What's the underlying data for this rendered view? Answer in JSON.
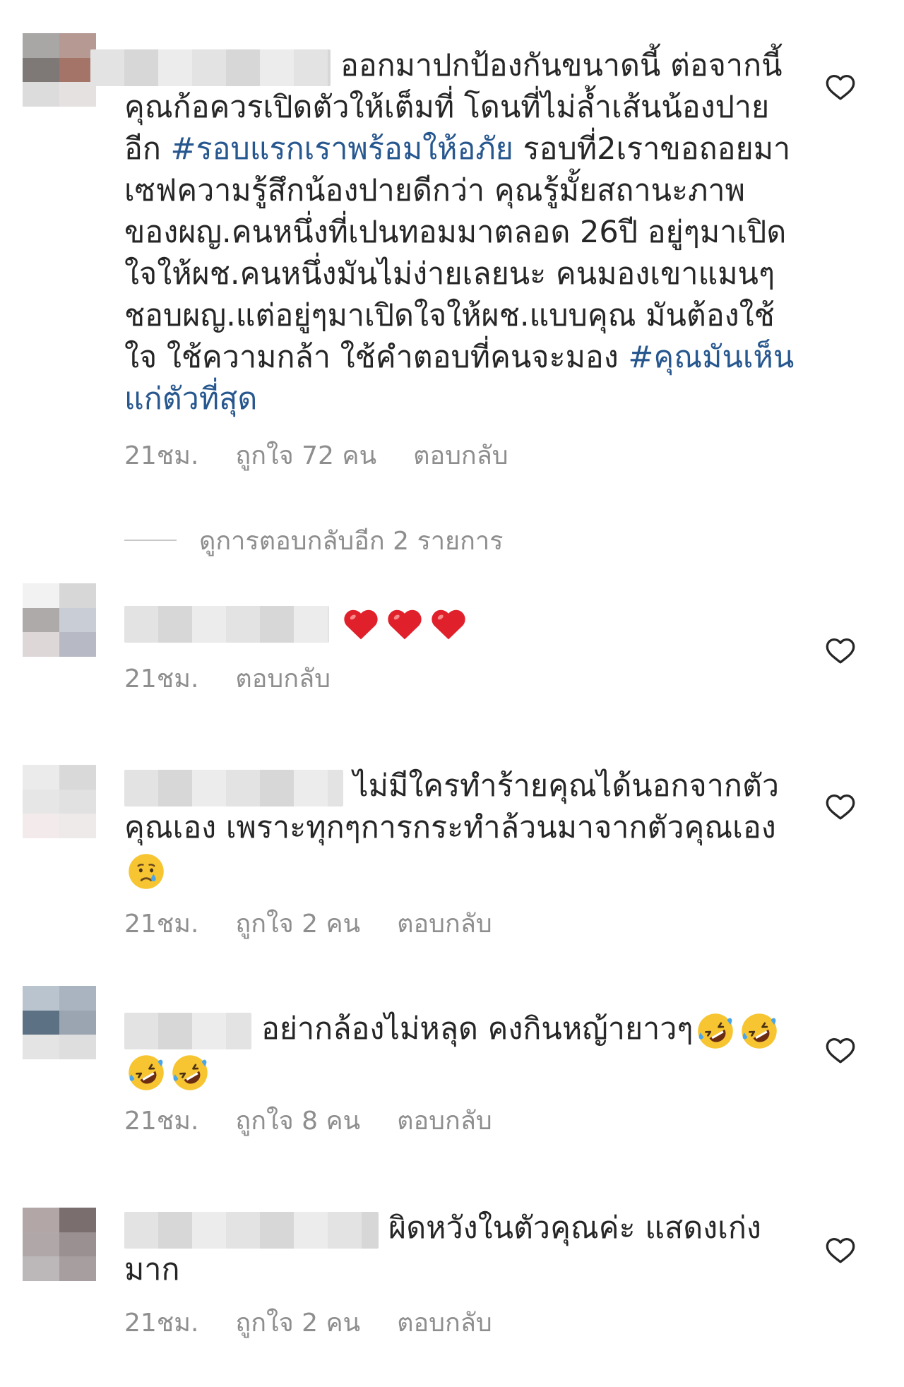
{
  "comments": [
    {
      "text_parts": [
        {
          "type": "text",
          "value": "ออกมาปกป้องกันขนาดนี้ ต่อจากนี้คุณก้อควรเปิดตัวให้เต็มที่ โดนที่ไม่ล้ำเส้นน้องปายอีก "
        },
        {
          "type": "hashtag",
          "value": "#รอบแรกเราพร้อมให้อภัย"
        },
        {
          "type": "text",
          "value": " รอบที่2เราขอถอยมาเซฟความรู้สึกน้องปายดีกว่า คุณรู้มั้ยสถานะภาพของผญ.คนหนึ่งที่เปนทอมมาตลอด 26ปี อยู่ๆมาเปิดใจให้ผช.คนหนึ่งมันไม่ง่ายเลยนะ คนมองเขาแมนๆชอบผญ.แต่อยู่ๆมาเปิดใจให้ผช.แบบคุณ มันต้องใช้ใจ ใช้ความกล้า ใช้คำตอบที่คนจะมอง "
        },
        {
          "type": "hashtag",
          "value": "#คุณมันเห็นแก่ตัวที่สุด"
        }
      ],
      "time": "21ชม.",
      "likes": "ถูกใจ 72 คน",
      "reply": "ตอบกลับ"
    },
    {
      "emojis": [
        "red-heart",
        "red-heart",
        "red-heart"
      ],
      "time": "21ชม.",
      "reply": "ตอบกลับ"
    },
    {
      "text": "ไม่มีใครทำร้ายคุณได้นอกจากตัวคุณเอง เพราะทุกๆการกระทำล้วนมาจากตัวคุณเอง",
      "emojis": [
        "crying-face"
      ],
      "time": "21ชม.",
      "likes": "ถูกใจ 2 คน",
      "reply": "ตอบกลับ"
    },
    {
      "text": "อย่ากล้องไม่หลุด คงกินหญ้ายาวๆ",
      "emojis": [
        "rolling-laughing-face",
        "rolling-laughing-face",
        "rolling-laughing-face",
        "rolling-laughing-face"
      ],
      "time": "21ชม.",
      "likes": "ถูกใจ 8 คน",
      "reply": "ตอบกลับ"
    },
    {
      "text": "ผิดหวังในตัวคุณค่ะ แสดงเก่งมาก",
      "time": "21ชม.",
      "likes": "ถูกใจ 2 คน",
      "reply": "ตอบกลับ"
    }
  ],
  "view_replies": "ดูการตอบกลับอีก 2 รายการ",
  "colors": {
    "text": "#262626",
    "meta": "#8e8e8e",
    "hashtag": "#27578f"
  },
  "icons": {
    "like": "heart-outline-icon"
  }
}
